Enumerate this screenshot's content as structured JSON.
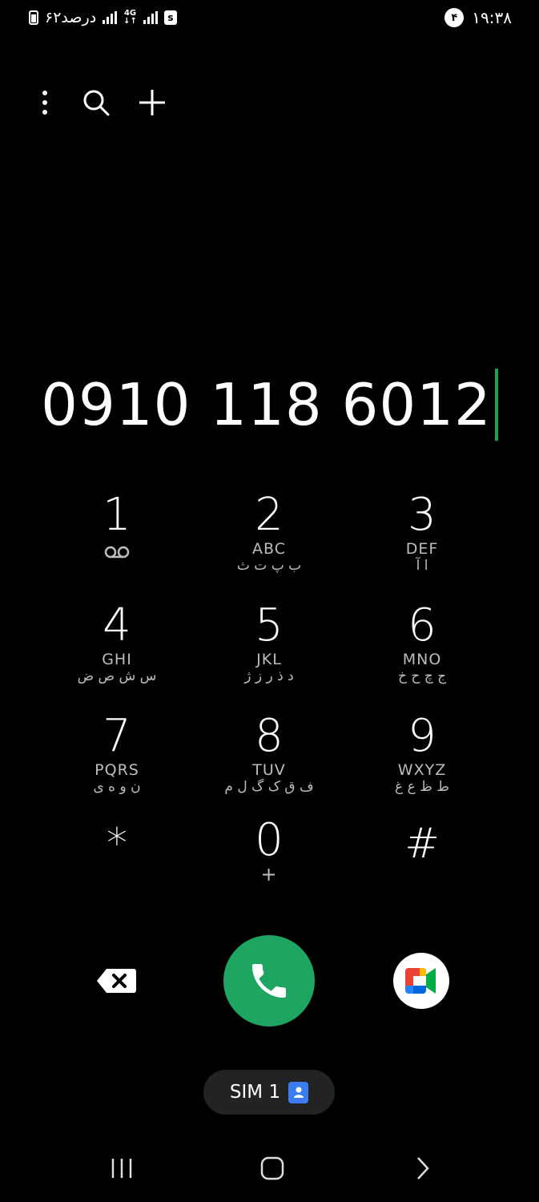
{
  "status_bar": {
    "time": "۱۹:۳۸",
    "notification_count": "۴",
    "battery_text": "۶۲درصد",
    "network_type": "4G"
  },
  "toolbar": {
    "more_icon": "more-vert-icon",
    "search_icon": "search-icon",
    "add_icon": "plus-icon"
  },
  "dialer": {
    "number": "0910 118 6012",
    "keys": [
      {
        "digit": "1",
        "letters": "",
        "fa": ""
      },
      {
        "digit": "2",
        "letters": "ABC",
        "fa": "ب پ ت ث"
      },
      {
        "digit": "3",
        "letters": "DEF",
        "fa": "ا آ"
      },
      {
        "digit": "4",
        "letters": "GHI",
        "fa": "س ش ص ض"
      },
      {
        "digit": "5",
        "letters": "JKL",
        "fa": "د ذ ر ز ژ"
      },
      {
        "digit": "6",
        "letters": "MNO",
        "fa": "ج چ ح خ"
      },
      {
        "digit": "7",
        "letters": "PQRS",
        "fa": "ن و ه ی"
      },
      {
        "digit": "8",
        "letters": "TUV",
        "fa": "ف ق ک گ ل م"
      },
      {
        "digit": "9",
        "letters": "WXYZ",
        "fa": "ط ظ ع غ"
      },
      {
        "digit": "*",
        "letters": "",
        "fa": ""
      },
      {
        "digit": "0",
        "letters": "+",
        "fa": ""
      },
      {
        "digit": "#",
        "letters": "",
        "fa": ""
      }
    ]
  },
  "actions": {
    "sim_label": "SIM 1",
    "call_color": "#1ea561",
    "sim_icon_color": "#3b7cf0"
  }
}
